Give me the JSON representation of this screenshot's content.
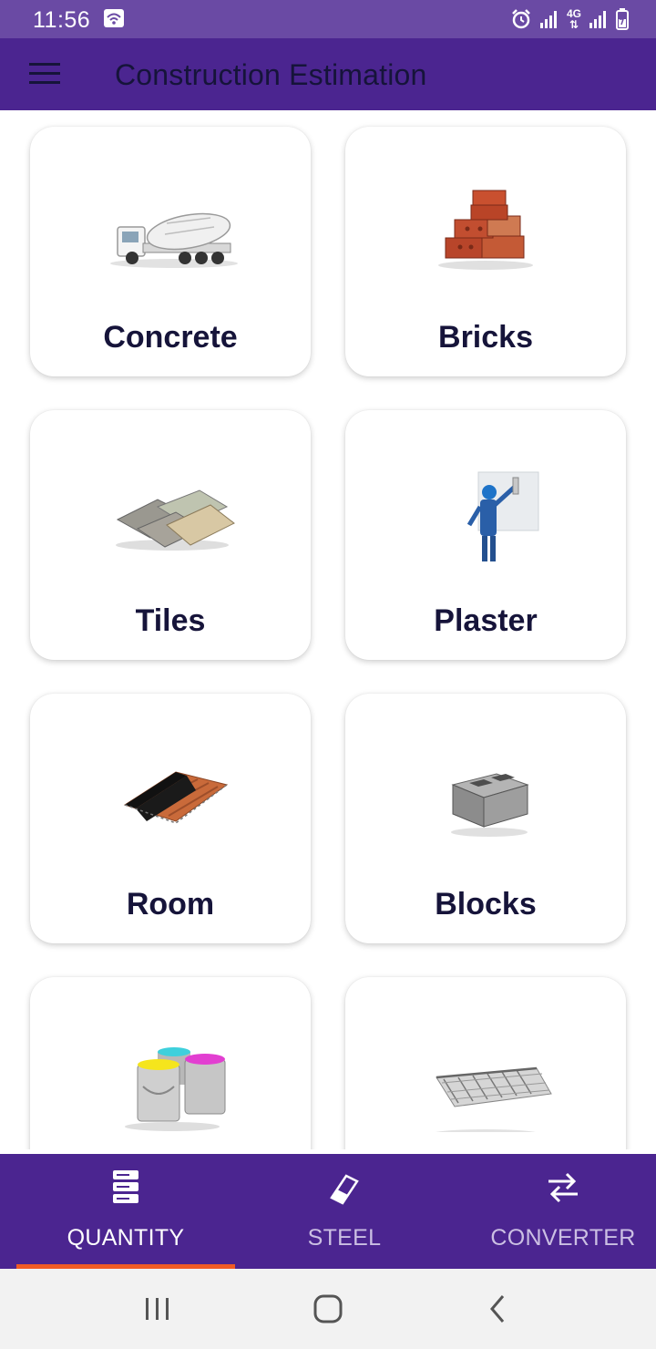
{
  "status_bar": {
    "time": "11:56",
    "network": "4G"
  },
  "app_bar": {
    "title": "Construction Estimation",
    "menu_icon": "hamburger-menu-icon"
  },
  "cards": [
    {
      "label": "Concrete",
      "image": "concrete-mixer-truck"
    },
    {
      "label": "Bricks",
      "image": "brick-pile"
    },
    {
      "label": "Tiles",
      "image": "stacked-tiles"
    },
    {
      "label": "Plaster",
      "image": "worker-plastering-wall"
    },
    {
      "label": "Room",
      "image": "roof-section"
    },
    {
      "label": "Blocks",
      "image": "concrete-block"
    },
    {
      "label": "",
      "image": "paint-buckets"
    },
    {
      "label": "",
      "image": "steel-mesh-beam"
    }
  ],
  "bottom_nav": {
    "active": "QUANTITY",
    "items": [
      {
        "label": "QUANTITY",
        "icon": "server-stack-icon",
        "color": "#ffffff"
      },
      {
        "label": "STEEL",
        "icon": "eraser-icon",
        "color": "#cbbfe3"
      },
      {
        "label": "CONVERTER",
        "icon": "swap-arrows-icon",
        "color": "#cbbfe3"
      }
    ]
  },
  "colors": {
    "primary": "#4b2590",
    "status_bar": "#6a4aa4",
    "accent": "#f05b24",
    "text_dark": "#16143a"
  }
}
